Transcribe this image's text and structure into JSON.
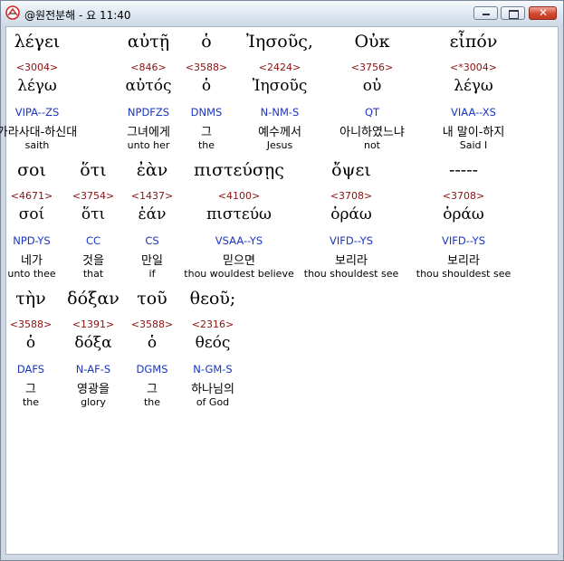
{
  "window": {
    "title": "@원전분해 - 요 11:40",
    "icon": "app-logo-icon",
    "buttons": [
      "minimize-button",
      "maximize-button",
      "close-button"
    ]
  },
  "rows": [
    [
      {
        "greek": "λέγει",
        "strong": "<3004>",
        "lemma": "λέγω",
        "parse": "VIPA--ZS",
        "korean": "가라사대-하신대",
        "english": "saith"
      },
      {
        "greek": "αὐτῇ",
        "strong": "<846>",
        "lemma": "αὐτός",
        "parse": "NPDFZS",
        "korean": "그녀에게",
        "english": "unto her"
      },
      {
        "greek": "ὁ",
        "strong": "<3588>",
        "lemma": "ὁ",
        "parse": "DNMS",
        "korean": "그",
        "english": "the"
      },
      {
        "greek": "Ἰησοῦς,",
        "strong": "<2424>",
        "lemma": "Ἰησοῦς",
        "parse": "N-NM-S",
        "korean": "예수께서",
        "english": "Jesus"
      },
      {
        "greek": "Οὐκ",
        "strong": "<3756>",
        "lemma": "οὐ",
        "parse": "QT",
        "korean": "아니하였느냐",
        "english": "not"
      },
      {
        "greek": "εἶπόν",
        "strong": "<*3004>",
        "lemma": "λέγω",
        "parse": "VIAA--XS",
        "korean": "내 말이-하지",
        "english": "Said I"
      }
    ],
    [
      {
        "greek": "σοι",
        "strong": "<4671>",
        "lemma": "σοί",
        "parse": "NPD-YS",
        "korean": "네가",
        "english": "unto thee"
      },
      {
        "greek": "ὅτι",
        "strong": "<3754>",
        "lemma": "ὅτι",
        "parse": "CC",
        "korean": "것을",
        "english": "that"
      },
      {
        "greek": "ἐὰν",
        "strong": "<1437>",
        "lemma": "ἐάν",
        "parse": "CS",
        "korean": "만일",
        "english": "if"
      },
      {
        "greek": "πιστεύσῃς",
        "strong": "<4100>",
        "lemma": "πιστεύω",
        "parse": "VSAA--YS",
        "korean": "믿으면",
        "english": "thou wouldest believe"
      },
      {
        "greek": "ὄψει",
        "strong": "<3708>",
        "lemma": "ὁράω",
        "parse": "VIFD--YS",
        "korean": "보리라",
        "english": "thou shouldest see"
      },
      {
        "greek": "-----",
        "strong": "<3708>",
        "lemma": "ὁράω",
        "parse": "VIFD--YS",
        "korean": "보리라",
        "english": "thou shouldest see"
      }
    ],
    [
      {
        "greek": "τὴν",
        "strong": "<3588>",
        "lemma": "ὁ",
        "parse": "DAFS",
        "korean": "그",
        "english": "the"
      },
      {
        "greek": "δόξαν",
        "strong": "<1391>",
        "lemma": "δόξα",
        "parse": "N-AF-S",
        "korean": "영광을",
        "english": "glory"
      },
      {
        "greek": "τοῦ",
        "strong": "<3588>",
        "lemma": "ὁ",
        "parse": "DGMS",
        "korean": "그",
        "english": "the"
      },
      {
        "greek": "θεοῦ;",
        "strong": "<2316>",
        "lemma": "θεός",
        "parse": "N-GM-S",
        "korean": "하나님의",
        "english": "of God"
      }
    ]
  ],
  "colors": {
    "strong": "#8b1010",
    "parse": "#1a35c0",
    "titlebar": "#dde6ef"
  }
}
